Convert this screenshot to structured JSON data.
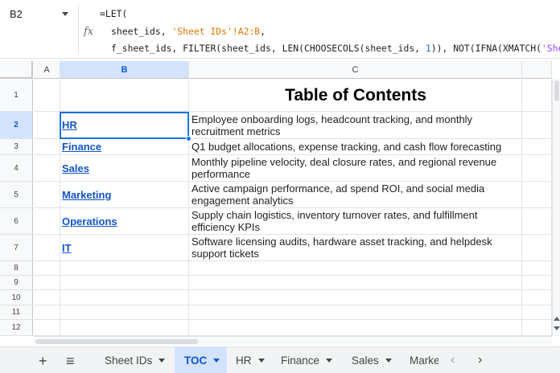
{
  "name_box": {
    "ref": "B2"
  },
  "formula": {
    "line1": "=LET(",
    "line2_pre": "sheet_ids, ",
    "line2_str": "'Sheet IDs'!A2:B",
    "line2_post": ",",
    "line3_pre": "f_sheet_ids, FILTER(sheet_ids, LEN(CHOOSECOLS(sheet_ids, ",
    "line3_num": "1",
    "line3_post": ")), NOT(IFNA(XMATCH(",
    "line3_str": "'Sheet"
  },
  "columns": [
    "A",
    "B",
    "C"
  ],
  "rows": [
    "1",
    "2",
    "3",
    "4",
    "5",
    "6",
    "7",
    "8",
    "9",
    "10",
    "11",
    "12"
  ],
  "title": "Table of Contents",
  "entries": [
    {
      "link": "HR",
      "desc": "Employee onboarding logs, headcount tracking, and monthly recruitment metrics"
    },
    {
      "link": "Finance",
      "desc": "Q1 budget allocations, expense tracking, and cash flow forecasting"
    },
    {
      "link": "Sales",
      "desc": "Monthly pipeline velocity, deal closure rates, and regional revenue performance"
    },
    {
      "link": "Marketing",
      "desc": "Active campaign performance, ad spend ROI, and social media engagement analytics"
    },
    {
      "link": "Operations",
      "desc": "Supply chain logistics, inventory turnover rates, and fulfillment efficiency KPIs"
    },
    {
      "link": "IT",
      "desc": "Software licensing audits, hardware asset tracking, and helpdesk support tickets"
    }
  ],
  "tabs": [
    {
      "label": "Sheet IDs"
    },
    {
      "label": "TOC"
    },
    {
      "label": "HR"
    },
    {
      "label": "Finance"
    },
    {
      "label": "Sales"
    },
    {
      "label": "Marke"
    }
  ],
  "icons": {
    "fx": "fx-icon",
    "add_sheet": "plus-icon",
    "all_sheets": "menu-icon",
    "prev": "chevron-left-icon",
    "next": "chevron-right-icon"
  },
  "colors": {
    "accent": "#1a73e8",
    "link": "#1155cc",
    "selected_header": "#d3e3fd"
  }
}
